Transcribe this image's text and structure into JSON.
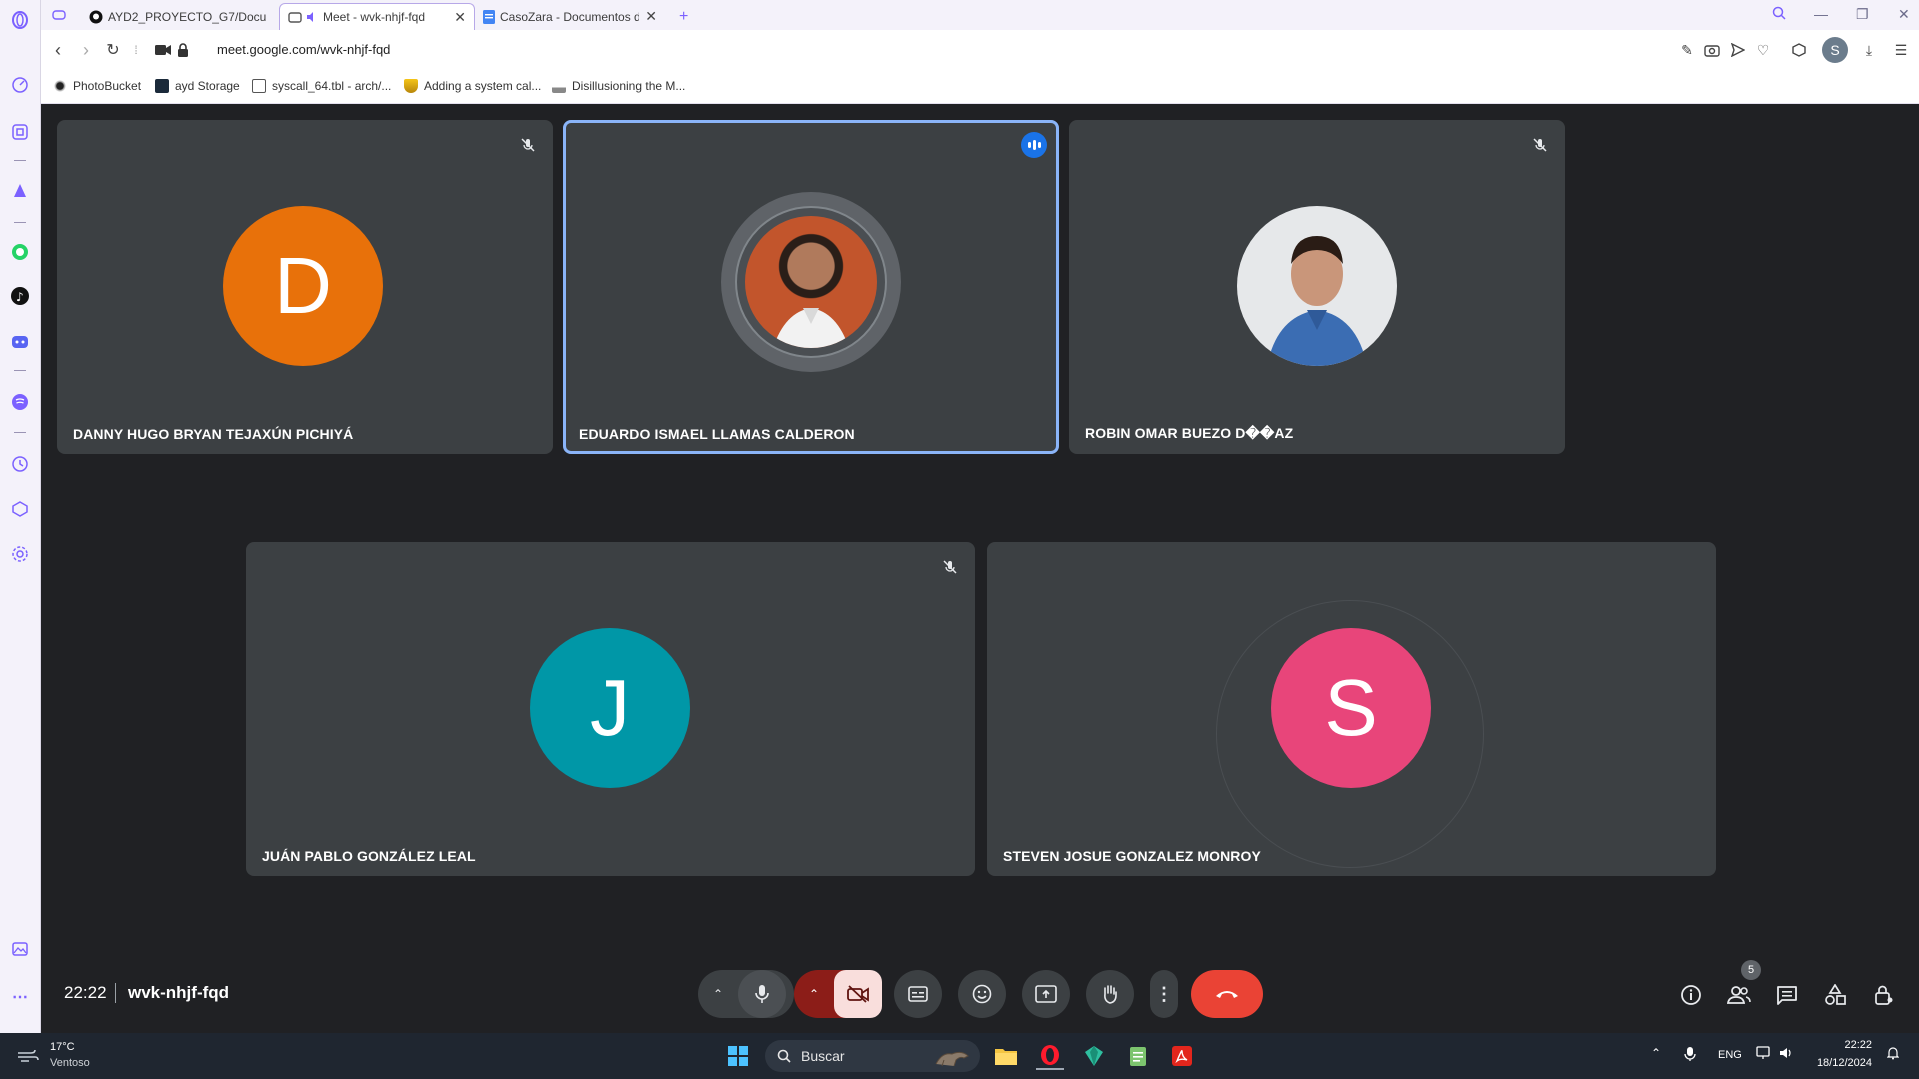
{
  "browser": {
    "tabs": [
      {
        "title": "AYD2_PROYECTO_G7/Docu",
        "active": false
      },
      {
        "title": "Meet - wvk-nhjf-fqd",
        "active": true
      },
      {
        "title": "CasoZara - Documentos de",
        "active": false
      }
    ],
    "new_tab_label": "+",
    "url": "meet.google.com/wvk-nhjf-fqd",
    "profile_initial": "S",
    "bookmarks": [
      {
        "label": "PhotoBucket",
        "icon": "photobucket-icon"
      },
      {
        "label": "ayd Storage",
        "icon": "react-icon"
      },
      {
        "label": "syscall_64.tbl - arch/...",
        "icon": "linux-icon"
      },
      {
        "label": "Adding a system cal...",
        "icon": "shield-icon"
      },
      {
        "label": "Disillusioning the M...",
        "icon": "chart-icon"
      }
    ]
  },
  "meet": {
    "participants": [
      {
        "name": "DANNY HUGO BRYAN TEJAXÚN PICHIYÁ",
        "initial": "D",
        "color": "#e8710a",
        "muted": true,
        "speaking": false,
        "photo": false
      },
      {
        "name": "EDUARDO ISMAEL LLAMAS CALDERON",
        "initial": "",
        "color": "#c0502a",
        "muted": false,
        "speaking": true,
        "photo": true
      },
      {
        "name": "ROBIN OMAR BUEZO D��AZ",
        "initial": "",
        "color": "#e6e8ea",
        "muted": true,
        "speaking": false,
        "photo": true
      },
      {
        "name": "JUÁN PABLO GONZÁLEZ LEAL",
        "initial": "J",
        "color": "#0097a7",
        "muted": true,
        "speaking": false,
        "photo": false
      },
      {
        "name": "STEVEN JOSUE GONZALEZ MONROY",
        "initial": "S",
        "color": "#e8457a",
        "muted": false,
        "speaking": false,
        "photo": false
      }
    ],
    "time": "22:22",
    "meeting_code": "wvk-nhjf-fqd",
    "people_count": "5",
    "colors": {
      "end_call": "#ea4335",
      "camera_off_bg": "#f9dedc",
      "camera_off_arrow_bg": "#8c1d18",
      "speaking_border": "#8ab4f8"
    }
  },
  "taskbar": {
    "temperature": "17°C",
    "condition": "Ventoso",
    "search_placeholder": "Buscar",
    "language": "ENG",
    "time": "22:22",
    "date": "18/12/2024"
  }
}
